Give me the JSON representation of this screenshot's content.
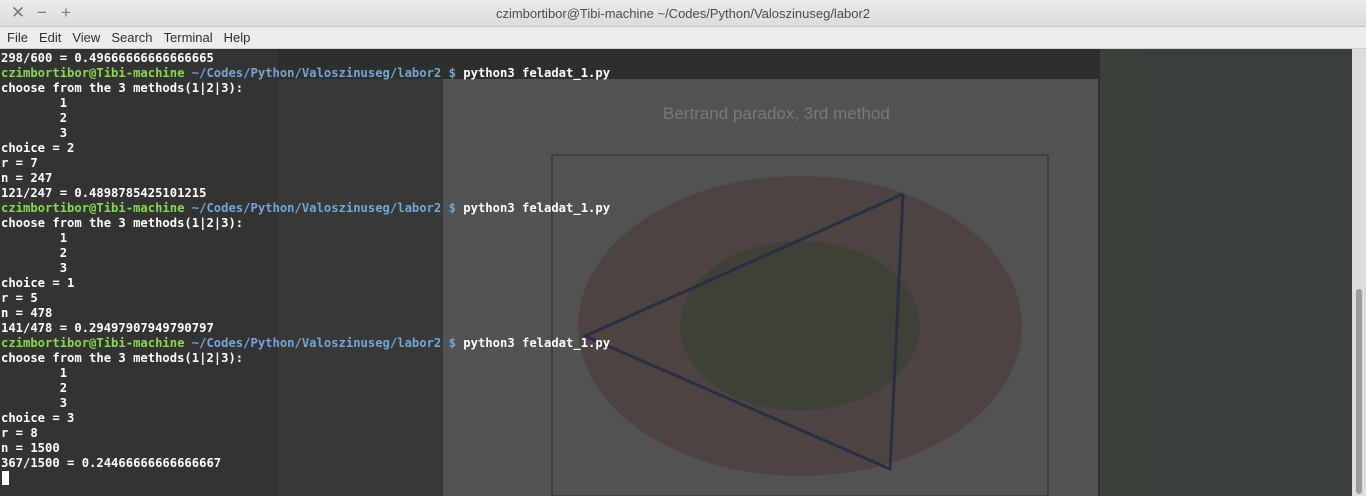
{
  "window": {
    "title": "czimbortibor@Tibi-machine ~/Codes/Python/Valoszinuseg/labor2",
    "close_glyph": "✕",
    "minimize_glyph": "−",
    "maximize_glyph": "+"
  },
  "menu": [
    "File",
    "Edit",
    "View",
    "Search",
    "Terminal",
    "Help"
  ],
  "prompt": {
    "user_host": "czimbortibor@Tibi-machine",
    "path": "~/Codes/Python/Valoszinuseg/labor2",
    "symbol": "$"
  },
  "lines": [
    {
      "kind": "out",
      "text": "298/600 = 0.49666666666666665"
    },
    {
      "kind": "prompt",
      "cmd": "python3 feladat_1.py"
    },
    {
      "kind": "out",
      "text": "choose from the 3 methods(1|2|3):"
    },
    {
      "kind": "out",
      "text": "        1"
    },
    {
      "kind": "out",
      "text": "        2"
    },
    {
      "kind": "out",
      "text": "        3"
    },
    {
      "kind": "out",
      "text": "choice = 2"
    },
    {
      "kind": "out",
      "text": "r = 7"
    },
    {
      "kind": "out",
      "text": "n = 247"
    },
    {
      "kind": "out",
      "text": "121/247 = 0.4898785425101215"
    },
    {
      "kind": "prompt",
      "cmd": "python3 feladat_1.py"
    },
    {
      "kind": "out",
      "text": "choose from the 3 methods(1|2|3):"
    },
    {
      "kind": "out",
      "text": "        1"
    },
    {
      "kind": "out",
      "text": "        2"
    },
    {
      "kind": "out",
      "text": "        3"
    },
    {
      "kind": "out",
      "text": "choice = 1"
    },
    {
      "kind": "out",
      "text": "r = 5"
    },
    {
      "kind": "out",
      "text": "n = 478"
    },
    {
      "kind": "out",
      "text": "141/478 = 0.29497907949790797"
    },
    {
      "kind": "prompt",
      "cmd": "python3 feladat_1.py"
    },
    {
      "kind": "out",
      "text": "choose from the 3 methods(1|2|3):"
    },
    {
      "kind": "out",
      "text": "        1"
    },
    {
      "kind": "out",
      "text": "        2"
    },
    {
      "kind": "out",
      "text": "        3"
    },
    {
      "kind": "out",
      "text": "choice = 3"
    },
    {
      "kind": "out",
      "text": "r = 8"
    },
    {
      "kind": "out",
      "text": "n = 1500"
    },
    {
      "kind": "out",
      "text": "367/1500 = 0.24466666666666667"
    }
  ],
  "background": {
    "plot_title": "Bertrand paradox, 3rd method"
  },
  "colors": {
    "prompt_user": "#88d94a",
    "prompt_path": "#74a6d8",
    "terminal_bg": "#2d2f2d"
  }
}
